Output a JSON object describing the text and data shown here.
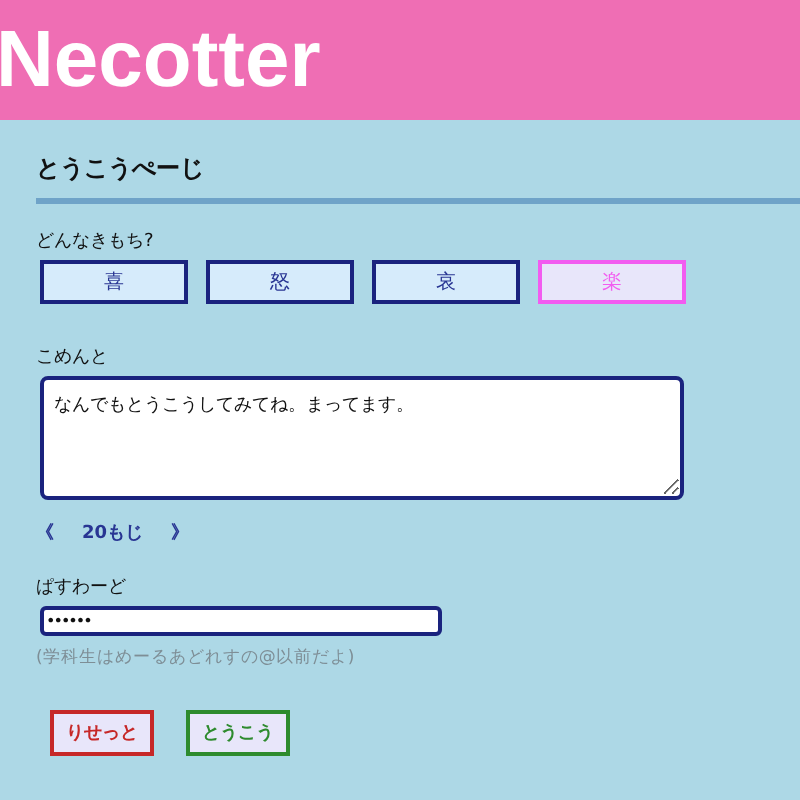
{
  "header": {
    "title": "Necotter"
  },
  "page": {
    "heading": "とうこうぺーじ"
  },
  "mood": {
    "label": "どんなきもち?",
    "options": [
      {
        "label": "喜",
        "selected": false
      },
      {
        "label": "怒",
        "selected": false
      },
      {
        "label": "哀",
        "selected": false
      },
      {
        "label": "楽",
        "selected": true
      }
    ]
  },
  "comment": {
    "label": "こめんと",
    "value": "なんでもとうこうしてみてね。まってます。",
    "counter": {
      "left": "《",
      "count": "20もじ",
      "right": "》"
    }
  },
  "password": {
    "label": "ぱすわーど",
    "value": "••••••",
    "hint": "(学科生はめーるあどれすの@以前だよ)"
  },
  "buttons": [
    {
      "label": "りせっと",
      "kind": "reset"
    },
    {
      "label": "とうこう",
      "kind": "submit"
    }
  ]
}
